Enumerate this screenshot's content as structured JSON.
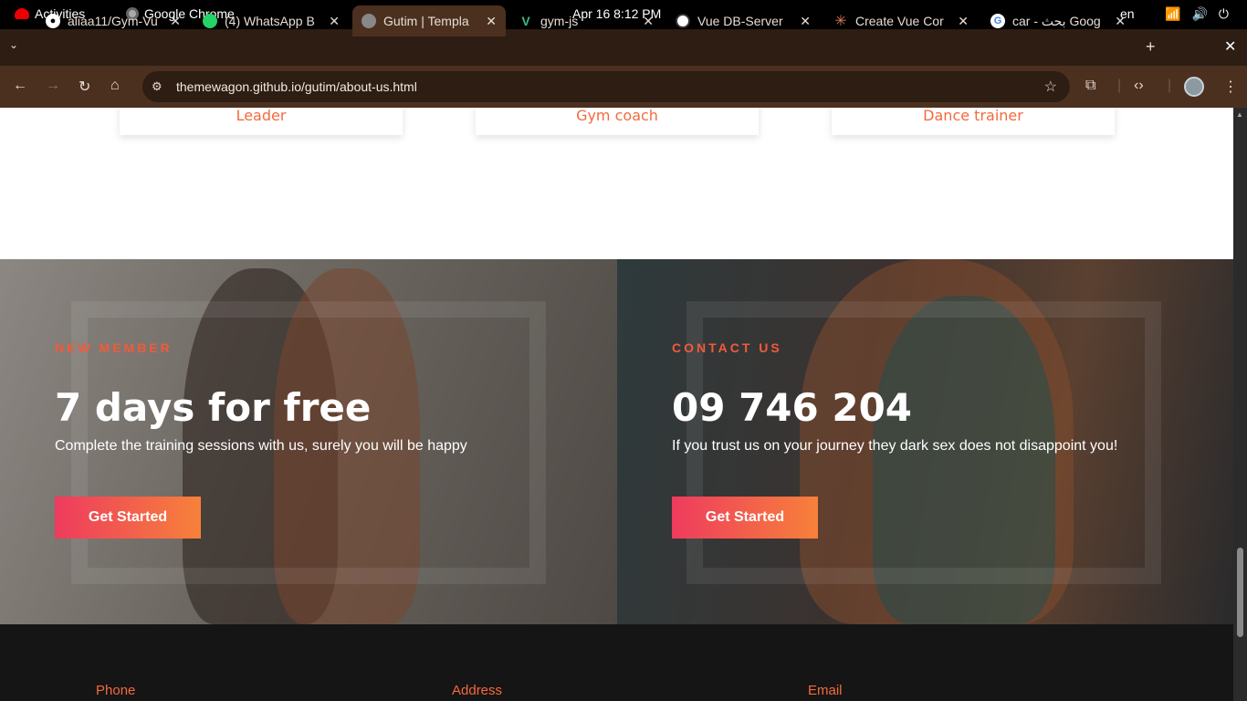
{
  "system_bar": {
    "activities": "Activities",
    "app_name": "Google Chrome",
    "clock": "Apr 16   8:12 PM",
    "language": "en",
    "tray_icons": [
      "wifi-icon",
      "volume-icon",
      "power-icon"
    ]
  },
  "tabs": [
    {
      "title": "aliaa11/Gym-Vu",
      "icon": "github-icon"
    },
    {
      "title": "(4) WhatsApp B",
      "icon": "whatsapp-icon"
    },
    {
      "title": "Gutim | Templa",
      "icon": "globe-icon",
      "active": true
    },
    {
      "title": "gym-js",
      "icon": "vue-icon"
    },
    {
      "title": "Vue DB-Server",
      "icon": "openai-icon"
    },
    {
      "title": "Create Vue Cor",
      "icon": "claude-icon"
    },
    {
      "title": "car - بحث Goog",
      "icon": "google-icon"
    }
  ],
  "toolbar": {
    "url": "themewagon.github.io/gutim/about-us.html"
  },
  "trainer_cards": [
    "Leader",
    "Gym coach",
    "Dance trainer"
  ],
  "promo_left": {
    "eyebrow": "NEW MEMBER",
    "heading": "7 days for free",
    "text": "Complete the training sessions with us, surely you will be happy",
    "button": "Get Started"
  },
  "promo_right": {
    "eyebrow": "CONTACT US",
    "heading": "09 746 204",
    "text": "If you trust us on your journey they dark sex does not disappoint you!",
    "button": "Get Started"
  },
  "footer": {
    "phone_label": "Phone",
    "address_label": "Address",
    "email_label": "Email"
  },
  "colors": {
    "accent": "#f36a3d",
    "button_gradient_start": "#ee3b5e",
    "button_gradient_end": "#f7813a",
    "chrome_frame": "#2d1d12",
    "chrome_toolbar": "#4b3020"
  }
}
